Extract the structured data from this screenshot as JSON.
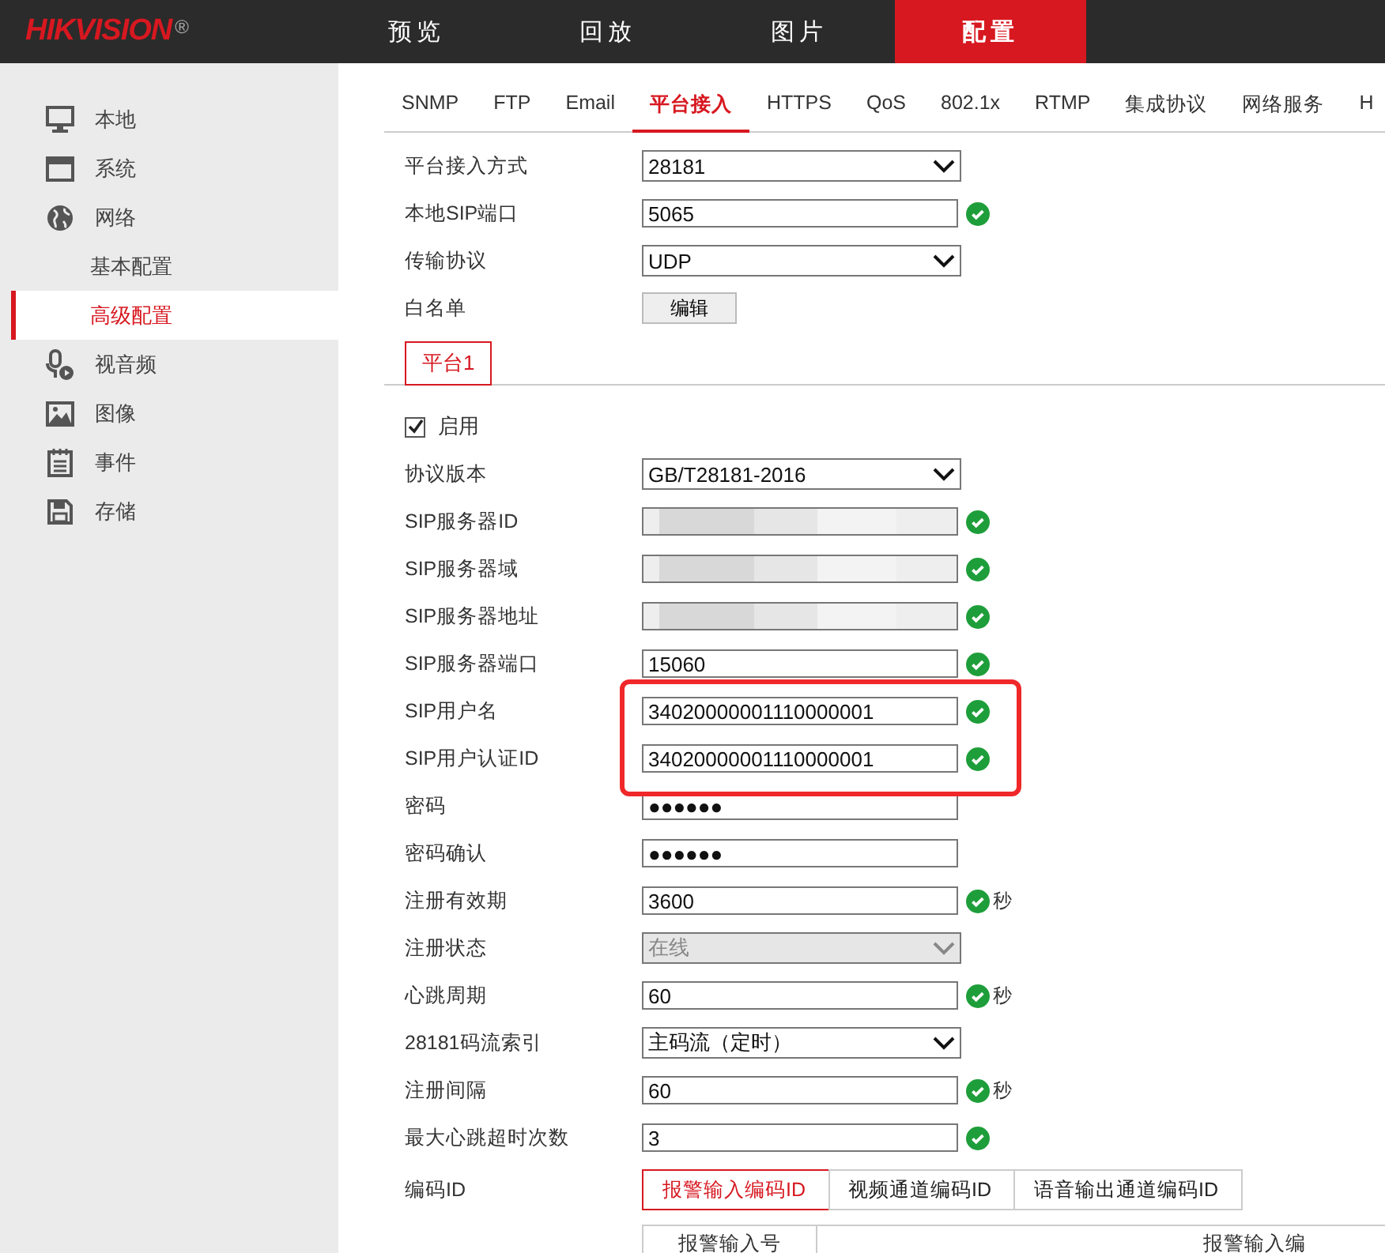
{
  "header": {
    "logo": "HIKVISION",
    "logo_mark": "®",
    "nav": [
      {
        "label": "预览",
        "selected": false
      },
      {
        "label": "回放",
        "selected": false
      },
      {
        "label": "图片",
        "selected": false
      },
      {
        "label": "配置",
        "selected": true
      }
    ]
  },
  "sidebar": {
    "items": [
      {
        "label": "本地",
        "selected": false
      },
      {
        "label": "系统",
        "selected": false
      },
      {
        "label": "网络",
        "selected": false,
        "children": [
          {
            "label": "基本配置",
            "selected": false
          },
          {
            "label": "高级配置",
            "selected": true
          }
        ]
      },
      {
        "label": "视音频",
        "selected": false
      },
      {
        "label": "图像",
        "selected": false
      },
      {
        "label": "事件",
        "selected": false
      },
      {
        "label": "存储",
        "selected": false
      }
    ]
  },
  "tabs": [
    {
      "label": "SNMP",
      "selected": false
    },
    {
      "label": "FTP",
      "selected": false
    },
    {
      "label": "Email",
      "selected": false
    },
    {
      "label": "平台接入",
      "selected": true
    },
    {
      "label": "HTTPS",
      "selected": false
    },
    {
      "label": "QoS",
      "selected": false
    },
    {
      "label": "802.1x",
      "selected": false
    },
    {
      "label": "RTMP",
      "selected": false
    },
    {
      "label": "集成协议",
      "selected": false
    },
    {
      "label": "网络服务",
      "selected": false
    },
    {
      "label": "H",
      "selected": false
    }
  ],
  "general_fields": [
    {
      "label": "平台接入方式",
      "kind": "select",
      "value": "28181"
    },
    {
      "label": "本地SIP端口",
      "kind": "input",
      "value": "5065",
      "valid": true
    },
    {
      "label": "传输协议",
      "kind": "select",
      "value": "UDP"
    },
    {
      "label": "白名单",
      "kind": "button",
      "value": "编辑"
    }
  ],
  "platform_tabs": [
    {
      "label": "平台1",
      "selected": true
    }
  ],
  "enable": {
    "label": "启用",
    "checked": true
  },
  "platform_fields": [
    {
      "label": "协议版本",
      "kind": "select",
      "value": "GB/T28181-2016"
    },
    {
      "label": "SIP服务器ID",
      "kind": "input",
      "redacted": true,
      "valid": true
    },
    {
      "label": "SIP服务器域",
      "kind": "input",
      "redacted": true,
      "valid": true
    },
    {
      "label": "SIP服务器地址",
      "kind": "input",
      "redacted": true,
      "valid": true
    },
    {
      "label": "SIP服务器端口",
      "kind": "input",
      "value": "15060",
      "valid": true
    },
    {
      "label": "SIP用户名",
      "kind": "input",
      "value": "34020000001110000001",
      "valid": true
    },
    {
      "label": "SIP用户认证ID",
      "kind": "input",
      "value": "34020000001110000001",
      "valid": true
    },
    {
      "label": "密码",
      "kind": "input",
      "value": "●●●●●●"
    },
    {
      "label": "密码确认",
      "kind": "input",
      "value": "●●●●●●"
    },
    {
      "label": "注册有效期",
      "kind": "input",
      "value": "3600",
      "valid": true,
      "unit": "秒"
    },
    {
      "label": "注册状态",
      "kind": "select",
      "value": "在线",
      "disabled": true
    },
    {
      "label": "心跳周期",
      "kind": "input",
      "value": "60",
      "valid": true,
      "unit": "秒"
    },
    {
      "label": "28181码流索引",
      "kind": "select",
      "value": "主码流（定时）"
    },
    {
      "label": "注册间隔",
      "kind": "input",
      "value": "60",
      "valid": true,
      "unit": "秒"
    },
    {
      "label": "最大心跳超时次数",
      "kind": "input",
      "value": "3",
      "valid": true
    }
  ],
  "code_id": {
    "label": "编码ID",
    "tabs": [
      {
        "label": "报警输入编码ID",
        "selected": true
      },
      {
        "label": "视频通道编码ID",
        "selected": false
      },
      {
        "label": "语音输出通道编码ID",
        "selected": false
      }
    ],
    "table": {
      "columns": [
        "报警输入号",
        "报警输入编"
      ]
    }
  }
}
